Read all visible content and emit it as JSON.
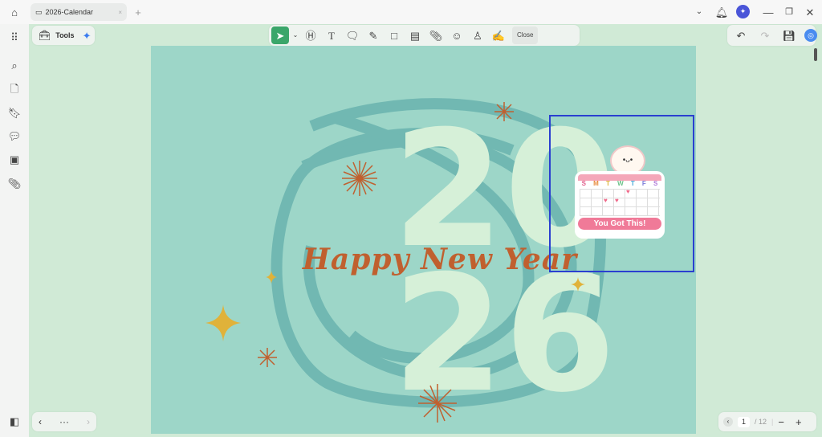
{
  "tab": {
    "title": "2026-Calendar",
    "close": "×",
    "new": "+"
  },
  "tools": {
    "label": "Tools"
  },
  "toolbar": {
    "close_label": "Close"
  },
  "page_content": {
    "year_top": "20",
    "year_bottom": "26",
    "greeting": "Happy New Year",
    "sticker": {
      "weekdays": [
        "S",
        "M",
        "T",
        "W",
        "T",
        "F",
        "S"
      ],
      "banner": "You Got This!"
    }
  },
  "pagination": {
    "current": "1",
    "total": "/ 12"
  },
  "bottom_nav": {
    "more": "···"
  },
  "colors": {
    "accent": "#3aa66a",
    "selection": "#2a3fd0",
    "page_bg": "#9dd6c8",
    "greeting": "#c0602f"
  }
}
